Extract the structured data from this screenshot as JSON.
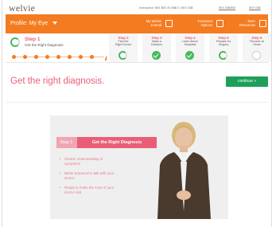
{
  "brand": {
    "logo": "welvie"
  },
  "topbar": {
    "info": "Interactive ⊞⊟ ⊠⊡ ⊞ ⊟⊠⊡ | ⊞⊟ ⊡⊠",
    "link_a": "⊞⊟ ⊡⊠⊞⊟",
    "link_b": "⊞⊟ ⊡⊠"
  },
  "nav": {
    "profile_label": "Profile: My Eye",
    "items": [
      {
        "label": "My Welvie\nJournal",
        "icon": "journal-icon"
      },
      {
        "label": "Treatment\nOptions",
        "icon": "options-icon"
      },
      {
        "label": "More\nResources",
        "icon": "resources-icon"
      }
    ]
  },
  "steps": {
    "current": {
      "title": "Step 1",
      "subtitle": "Get the Right Diagnosis"
    },
    "others": [
      {
        "num": "Step 2",
        "label": "Find the\nRight Doctor",
        "state": "in-progress"
      },
      {
        "num": "Step 3",
        "label": "Make a\nDecision",
        "state": "done"
      },
      {
        "num": "Step 4",
        "label": "Learn About\nHospitals",
        "state": "done"
      },
      {
        "num": "Step 5",
        "label": "Prepare for\nSurgery",
        "state": "in-progress"
      },
      {
        "num": "Step 6",
        "label": "Recover at\nHome",
        "state": "not-started"
      }
    ]
  },
  "headline": "Get the right diagnosis.",
  "continue_label": "continue »",
  "video": {
    "step_label": "Step 1:",
    "title": "Get the Right Diagnosis",
    "bullets": [
      "Clearer understanding of symptoms",
      "Better prepared to talk with your doctor",
      "Ready to make the most of your doctor visit"
    ]
  },
  "colors": {
    "orange": "#f47b20",
    "pink": "#e95e76",
    "green": "#48b85d",
    "continue_green": "#1fa05a"
  }
}
